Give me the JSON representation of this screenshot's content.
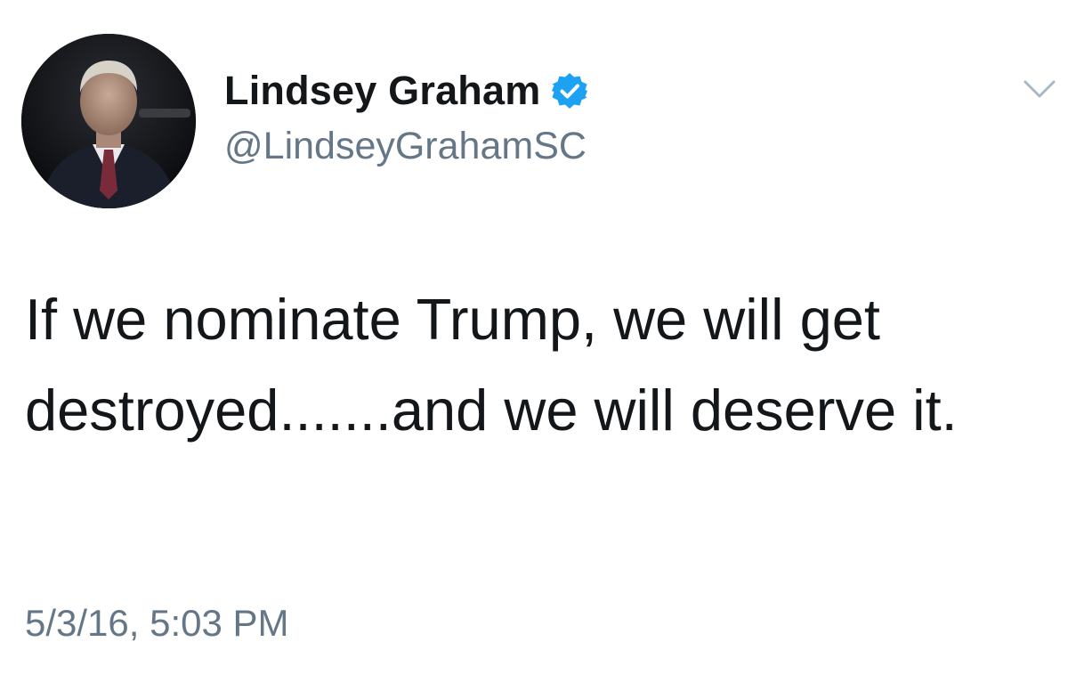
{
  "author": {
    "display_name": "Lindsey Graham",
    "handle": "@LindseyGrahamSC",
    "verified": true,
    "avatar_icon": "profile-photo"
  },
  "tweet": {
    "text": "If we nominate Trump, we will get destroyed.......and we will deserve it.",
    "timestamp": "5/3/16, 5:03 PM"
  },
  "colors": {
    "text_primary": "#14171a",
    "text_secondary": "#657786",
    "verified_badge": "#1da1f2",
    "caret": "#aab8c2"
  },
  "icons": {
    "verified": "verified-badge-icon",
    "more": "chevron-down-icon"
  }
}
